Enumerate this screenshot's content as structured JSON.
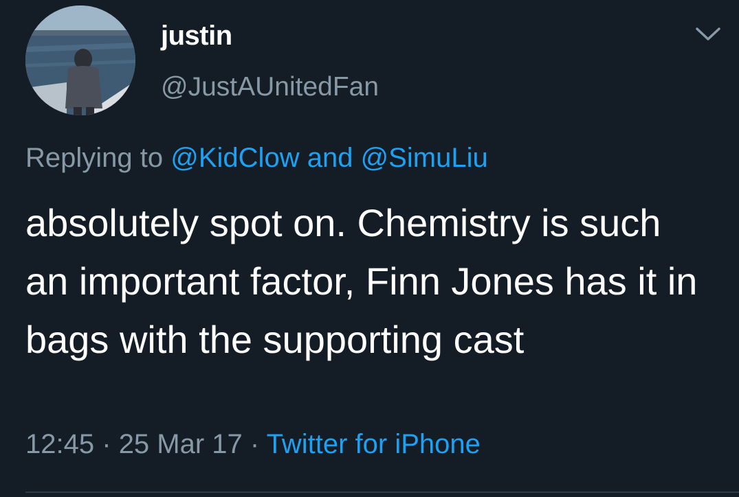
{
  "tweet": {
    "author": {
      "display_name": "justin",
      "handle": "@JustAUnitedFan"
    },
    "reply": {
      "prefix": "Replying to",
      "mention1": "@KidClow",
      "joiner": "and",
      "mention2": "@SimuLiu"
    },
    "text": "absolutely spot on. Chemistry is such an important factor, Finn Jones has it in bags with the supporting cast",
    "meta": {
      "time": "12:45",
      "sep1": "·",
      "date": "25 Mar 17",
      "sep2": "·",
      "source": "Twitter for iPhone"
    }
  },
  "icons": {
    "menu": "chevron-down-icon"
  },
  "colors": {
    "background": "#141d26",
    "text": "#ffffff",
    "muted": "#8899a6",
    "link": "#1da1f2"
  }
}
